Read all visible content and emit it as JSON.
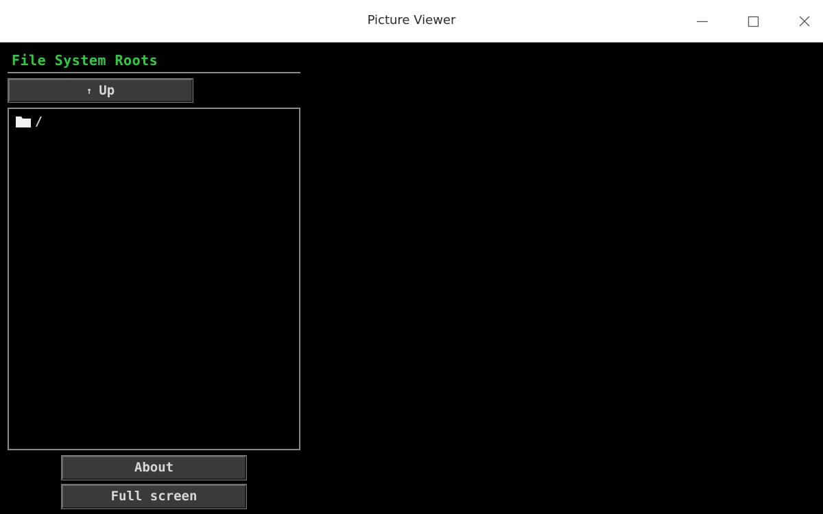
{
  "window": {
    "title": "Picture Viewer",
    "minimize_icon": "minimize-icon",
    "maximize_icon": "maximize-icon",
    "close_icon": "close-icon"
  },
  "panel": {
    "title": "File System Roots",
    "title_color": "#2ecc40",
    "up_button": {
      "arrow": "↑",
      "label": "Up",
      "icon": "arrow-up-icon"
    },
    "items": [
      {
        "icon": "folder-icon",
        "label": "/"
      }
    ]
  },
  "buttons": {
    "about_label": "About",
    "fullscreen_label": "Full screen"
  },
  "colors": {
    "background": "#000000",
    "button_face": "#3a3a3a",
    "button_text": "#d8d8d8",
    "border": "#8a8a8a"
  }
}
